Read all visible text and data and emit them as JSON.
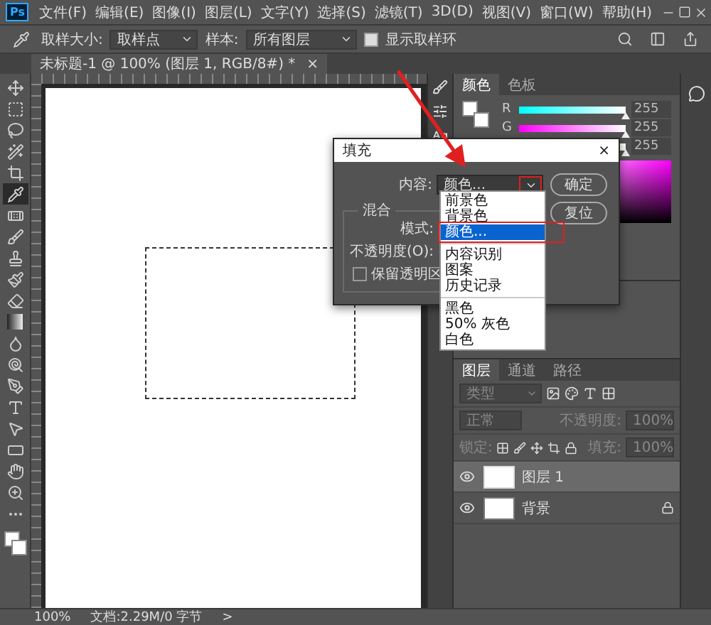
{
  "menu_bar": {
    "logo": "Ps",
    "items": [
      "文件(F)",
      "编辑(E)",
      "图像(I)",
      "图层(L)",
      "文字(Y)",
      "选择(S)",
      "滤镜(T)",
      "3D(D)",
      "视图(V)",
      "窗口(W)",
      "帮助(H)"
    ]
  },
  "options_bar": {
    "sample_size_label": "取样大小:",
    "sample_size": "取样点",
    "sample_label": "样本:",
    "sample": "所有图层",
    "show_ring": {
      "label": "显示取样环",
      "checked": true
    }
  },
  "document_tab": {
    "title": "未标题-1 @ 100% (图层 1, RGB/8#) *",
    "close": "×"
  },
  "tools": [
    {
      "kind": "move",
      "selected": false
    },
    {
      "kind": "marquee",
      "selected": false
    },
    {
      "kind": "lasso",
      "selected": false
    },
    {
      "kind": "wand",
      "selected": false
    },
    {
      "kind": "crop",
      "selected": false
    },
    {
      "kind": "eyedropper",
      "selected": true
    },
    {
      "kind": "healing",
      "selected": false
    },
    {
      "kind": "brush",
      "selected": false
    },
    {
      "kind": "stamp",
      "selected": false
    },
    {
      "kind": "history",
      "selected": false
    },
    {
      "kind": "eraser",
      "selected": false
    },
    {
      "kind": "gradient",
      "selected": false
    },
    {
      "kind": "blur",
      "selected": false
    },
    {
      "kind": "dodge",
      "selected": false
    },
    {
      "kind": "pen",
      "selected": false
    },
    {
      "kind": "type",
      "selected": false
    },
    {
      "kind": "path",
      "selected": false
    },
    {
      "kind": "shape",
      "selected": false
    },
    {
      "kind": "hand",
      "selected": false
    },
    {
      "kind": "zoom",
      "selected": false
    },
    {
      "kind": "more",
      "selected": false
    }
  ],
  "color_panel": {
    "tabs": [
      {
        "label": "颜色",
        "selected": true
      },
      {
        "label": "色板",
        "selected": false
      }
    ],
    "sliders": [
      {
        "channel": "R",
        "level": 1,
        "reading": "255"
      },
      {
        "channel": "G",
        "level": 1,
        "reading": "255"
      },
      {
        "level": 1,
        "reading": "255"
      }
    ]
  },
  "layers_panel": {
    "tabs": [
      {
        "label": "图层",
        "selected": true
      },
      {
        "label": "通道",
        "selected": false
      },
      {
        "label": "路径",
        "selected": false
      }
    ],
    "filter_placeholder": "类型",
    "blend_mode": "正常",
    "opacity_label": "不透明度:",
    "opacity": "100%",
    "lock_label": "锁定:",
    "fill_label": "填充:",
    "fill": "100%",
    "layers": [
      {
        "name": "图层 1",
        "selected": true,
        "visible": true,
        "locked": false
      },
      {
        "name": "背景",
        "selected": false,
        "visible": true,
        "locked": true
      }
    ]
  },
  "status_bar": {
    "zoom": "100%",
    "doc_info": "文档:2.29M/0 字节",
    "arrow": ">"
  },
  "fill_dialog": {
    "title": "填充",
    "close": "×",
    "contents_label": "内容:",
    "contents_value": "颜色...",
    "ok": "确定",
    "reset": "复位",
    "blending_label": "混合",
    "mode_label": "模式:",
    "opacity_label": "不透明度(O):",
    "preserve": {
      "label": "保留透明区",
      "checked": false
    },
    "options": [
      {
        "kind": "option",
        "label": "前景色",
        "selected": false
      },
      {
        "kind": "option",
        "label": "背景色",
        "selected": false
      },
      {
        "kind": "option",
        "label": "颜色...",
        "selected": true
      },
      {
        "kind": "separator"
      },
      {
        "kind": "option",
        "label": "内容识别",
        "selected": false
      },
      {
        "kind": "option",
        "label": "图案",
        "selected": false
      },
      {
        "kind": "option",
        "label": "历史记录",
        "selected": false
      },
      {
        "kind": "separator"
      },
      {
        "kind": "option",
        "label": "黑色",
        "selected": false
      },
      {
        "kind": "option",
        "label": "50% 灰色",
        "selected": false
      },
      {
        "kind": "option",
        "label": "白色",
        "selected": false
      }
    ]
  }
}
